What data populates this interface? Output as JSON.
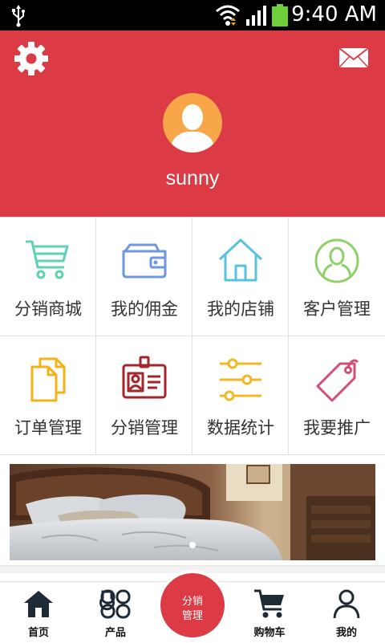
{
  "status_bar": {
    "time": "9:40 AM",
    "icons": [
      "usb-icon",
      "wifi-icon",
      "signal-icon",
      "battery-icon"
    ]
  },
  "header": {
    "username": "sunny",
    "background_color": "#dc3a45",
    "icons": [
      "settings-gear-icon",
      "mail-icon",
      "avatar-icon"
    ]
  },
  "menu": {
    "items": [
      {
        "label": "分销商城",
        "icon": "shopping-cart-icon",
        "color": "#5fd1b5"
      },
      {
        "label": "我的佣金",
        "icon": "wallet-icon",
        "color": "#6f96e0"
      },
      {
        "label": "我的店铺",
        "icon": "house-icon",
        "color": "#58c3dc"
      },
      {
        "label": "客户管理",
        "icon": "user-circle-icon",
        "color": "#8fd069"
      },
      {
        "label": "订单管理",
        "icon": "documents-icon",
        "color": "#f3b316"
      },
      {
        "label": "分销管理",
        "icon": "id-badge-icon",
        "color": "#a5242a"
      },
      {
        "label": "数据统计",
        "icon": "sliders-icon",
        "color": "#f1b824"
      },
      {
        "label": "我要推广",
        "icon": "price-tag-icon",
        "color": "#d14e74"
      }
    ]
  },
  "banner": {
    "icon": "bedroom-banner-image"
  },
  "tab_bar": {
    "tabs": [
      {
        "label": "首页",
        "icon": "home-icon"
      },
      {
        "label": "产品",
        "icon": "products-grid-icon"
      },
      {
        "label": "购物车",
        "icon": "cart-icon"
      },
      {
        "label": "我的",
        "icon": "profile-icon"
      }
    ],
    "center_button": {
      "line1": "分销",
      "line2": "管理"
    }
  }
}
